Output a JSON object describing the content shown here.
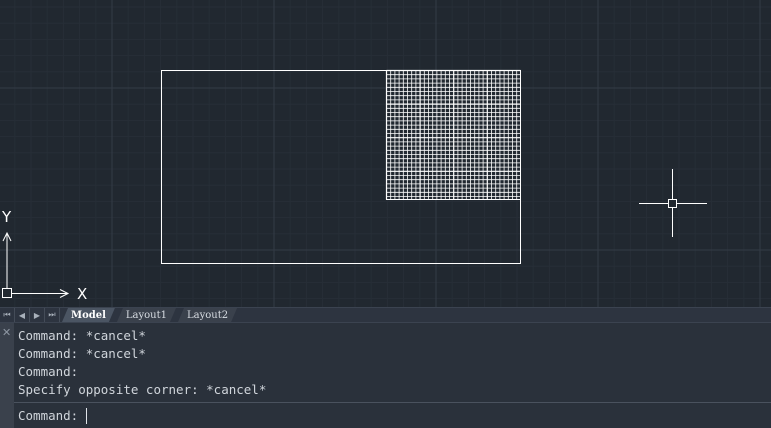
{
  "canvas": {
    "axis_labels": {
      "x": "X",
      "y": "Y"
    }
  },
  "tabs": {
    "items": [
      {
        "label": "Model",
        "active": true
      },
      {
        "label": "Layout1",
        "active": false
      },
      {
        "label": "Layout2",
        "active": false
      }
    ]
  },
  "command": {
    "history": [
      "Command: *cancel*",
      "Command: *cancel*",
      "Command:",
      "Specify opposite corner: *cancel*"
    ],
    "prompt": "Command:"
  },
  "colors": {
    "canvas_bg": "#212830",
    "grid_major": "#353c47",
    "geometry": "#ffffff"
  },
  "icons": {
    "close": "close-icon",
    "crosshair": "crosshair-cursor-icon",
    "ucs": "ucs-icon"
  }
}
